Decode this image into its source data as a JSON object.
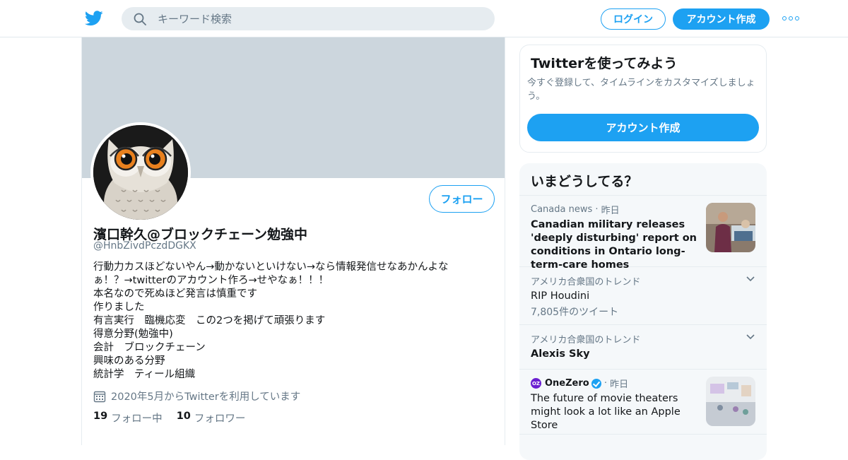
{
  "header": {
    "search_placeholder": "キーワード検索",
    "login_label": "ログイン",
    "signup_label": "アカウント作成"
  },
  "profile": {
    "follow_label": "フォロー",
    "display_name": "濱口幹久@ブロックチェーン勉強中",
    "handle": "@HnbZivdPczdDGKX",
    "bio_lines": [
      "行動力カスほどないやん→動かないといけない→なら情報発信せなあかんよな",
      "ぁ！？→twitterのアカウント作ろ→せやなぁ！！！",
      "本名なので死ぬほど発言は慎重です",
      "作りました",
      "有言実行　臨機応変　この2つを掲げて頑張ります",
      "得意分野(勉強中)",
      "会計　ブロックチェーン",
      "興味のある分野",
      "統計学　ティール組織"
    ],
    "joined": "2020年5月からTwitterを利用しています",
    "following_count": "19",
    "following_label": "フォロー中",
    "followers_count": "10",
    "followers_label": "フォロワー"
  },
  "signup_card": {
    "title": "Twitterを使ってみよう",
    "description": "今すぐ登録して、タイムラインをカスタマイズしましょう。",
    "button_label": "アカウント作成"
  },
  "trends": {
    "title": "いまどうしてる？",
    "items": [
      {
        "source": "Canada news",
        "time": "昨日",
        "headline": "Canadian military releases 'deeply disturbing' report on conditions in Ontario long-term-care homes"
      },
      {
        "context": "アメリカ合衆国のトレンド",
        "headline": "RIP Houdini",
        "count": "7,805件のツイート"
      },
      {
        "context": "アメリカ合衆国のトレンド",
        "headline": "Alexis Sky"
      },
      {
        "source_badge": "OZ",
        "source": "OneZero",
        "time": "昨日",
        "headline": "The future of movie theaters might look a lot like an Apple Store"
      }
    ]
  },
  "colors": {
    "accent": "#1da1f2",
    "banner": "#ccd6dd",
    "secondary_text": "#657786"
  }
}
